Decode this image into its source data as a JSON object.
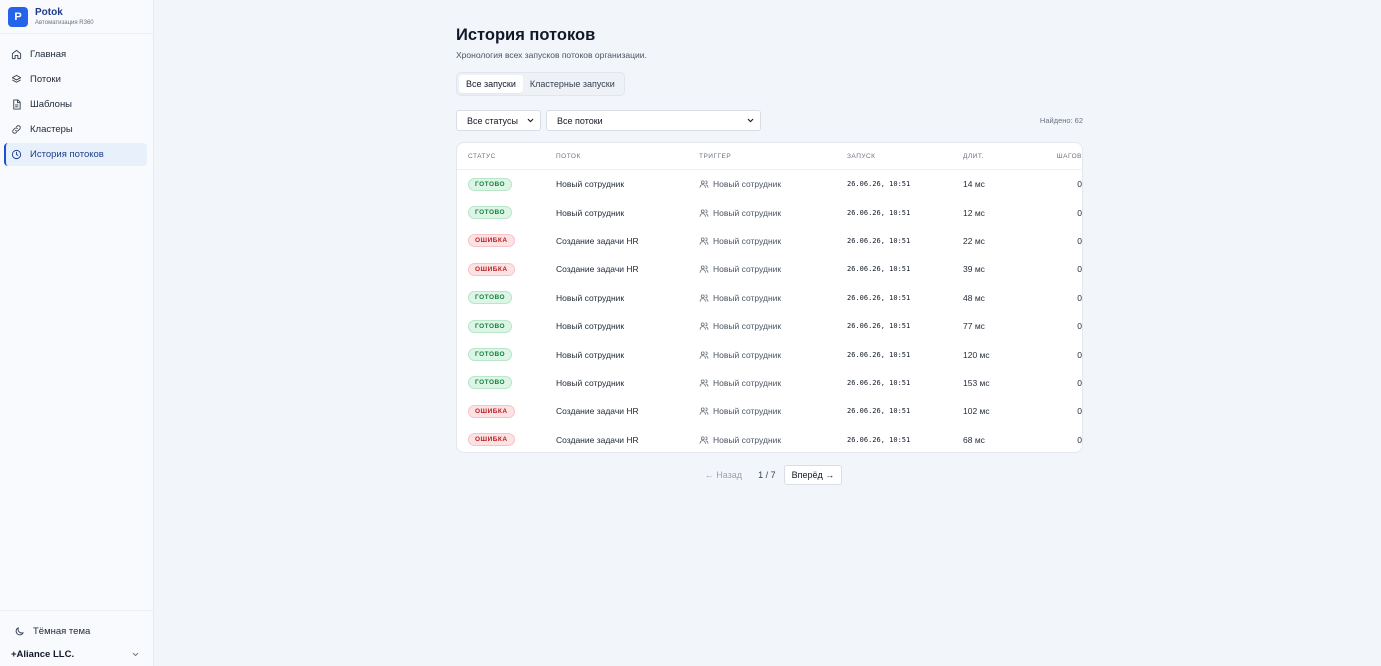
{
  "brand": {
    "logo_letter": "P",
    "name": "Potok",
    "subtitle": "Автоматизация R360"
  },
  "sidebar": {
    "items": [
      {
        "label": "Главная",
        "icon": "home-icon",
        "active": false
      },
      {
        "label": "Потоки",
        "icon": "layers-icon",
        "active": false
      },
      {
        "label": "Шаблоны",
        "icon": "document-icon",
        "active": false
      },
      {
        "label": "Кластеры",
        "icon": "link-icon",
        "active": false
      },
      {
        "label": "История потоков",
        "icon": "clock-icon",
        "active": true
      }
    ],
    "theme_toggle": "Тёмная тема",
    "org_name": "+Aliance LLC."
  },
  "page": {
    "title": "История потоков",
    "subtitle": "Хронология всех запусков потоков организации."
  },
  "tabs": [
    {
      "label": "Все запуски",
      "active": true
    },
    {
      "label": "Кластерные запуски",
      "active": false
    }
  ],
  "filters": {
    "status": "Все статусы",
    "flows": "Все потоки",
    "found_label": "Найдено:",
    "found_count": "62"
  },
  "table": {
    "columns": {
      "status": "СТАТУС",
      "flow": "ПОТОК",
      "trigger": "ТРИГГЕР",
      "start": "ЗАПУСК",
      "duration": "ДЛИТ.",
      "steps": "ШАГОВ"
    },
    "rows": [
      {
        "status": "ГОТОВО",
        "type": "ok",
        "flow": "Новый сотрудник",
        "trigger": "Новый сотрудник",
        "start": "26.06.26, 10:51",
        "duration": "14 мс",
        "steps": "0"
      },
      {
        "status": "ГОТОВО",
        "type": "ok",
        "flow": "Новый сотрудник",
        "trigger": "Новый сотрудник",
        "start": "26.06.26, 10:51",
        "duration": "12 мс",
        "steps": "0"
      },
      {
        "status": "ОШИБКА",
        "type": "err",
        "flow": "Создание задачи HR",
        "trigger": "Новый сотрудник",
        "start": "26.06.26, 10:51",
        "duration": "22 мс",
        "steps": "0"
      },
      {
        "status": "ОШИБКА",
        "type": "err",
        "flow": "Создание задачи HR",
        "trigger": "Новый сотрудник",
        "start": "26.06.26, 10:51",
        "duration": "39 мс",
        "steps": "0"
      },
      {
        "status": "ГОТОВО",
        "type": "ok",
        "flow": "Новый сотрудник",
        "trigger": "Новый сотрудник",
        "start": "26.06.26, 10:51",
        "duration": "48 мс",
        "steps": "0"
      },
      {
        "status": "ГОТОВО",
        "type": "ok",
        "flow": "Новый сотрудник",
        "trigger": "Новый сотрудник",
        "start": "26.06.26, 10:51",
        "duration": "77 мс",
        "steps": "0"
      },
      {
        "status": "ГОТОВО",
        "type": "ok",
        "flow": "Новый сотрудник",
        "trigger": "Новый сотрудник",
        "start": "26.06.26, 10:51",
        "duration": "120 мс",
        "steps": "0"
      },
      {
        "status": "ГОТОВО",
        "type": "ok",
        "flow": "Новый сотрудник",
        "trigger": "Новый сотрудник",
        "start": "26.06.26, 10:51",
        "duration": "153 мс",
        "steps": "0"
      },
      {
        "status": "ОШИБКА",
        "type": "err",
        "flow": "Создание задачи HR",
        "trigger": "Новый сотрудник",
        "start": "26.06.26, 10:51",
        "duration": "102 мс",
        "steps": "0"
      },
      {
        "status": "ОШИБКА",
        "type": "err",
        "flow": "Создание задачи HR",
        "trigger": "Новый сотрудник",
        "start": "26.06.26, 10:51",
        "duration": "68 мс",
        "steps": "0"
      }
    ]
  },
  "pagination": {
    "prev": "← Назад",
    "page": "1 / 7",
    "next": "Вперёд →"
  },
  "colors": {
    "accent": "#2563eb",
    "ok_bg": "#dcf5e6",
    "ok_text": "#15803d",
    "err_bg": "#fde2e4",
    "err_text": "#b91c1c"
  }
}
